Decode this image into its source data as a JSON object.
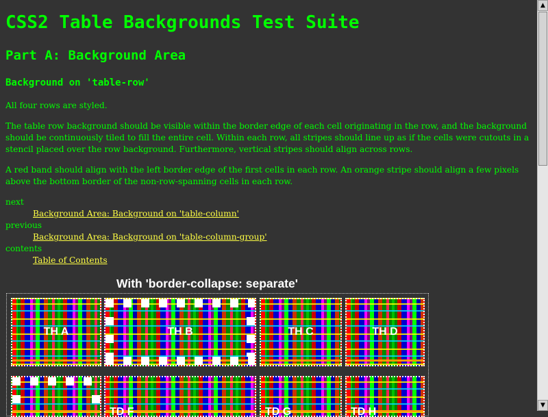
{
  "page": {
    "title": "CSS2 Table Backgrounds Test Suite",
    "part": "Part A: Background Area",
    "section": "Background on 'table-row'",
    "paragraphs": [
      "All four rows are styled.",
      "The table row background should be visible within the border edge of each cell originating in the row, and the background should be continuously tiled to fill the entire cell. Within each row, all stripes should line up as if the cells were cutouts in a stencil placed over the row background. Furthermore, vertical stripes should align across rows.",
      "A red band should align with the left border edge of the first cells in each row. An orange stripe should align a few pixels above the bottom border of the non-row-spanning cells in each row."
    ]
  },
  "nav": {
    "next_label": "next",
    "next_link": "Background Area: Background on 'table-column'",
    "previous_label": "previous",
    "previous_link": "Background Area: Background on 'table-column-group'",
    "contents_label": "contents",
    "contents_link": "Table of Contents"
  },
  "demo": {
    "caption": "With 'border-collapse: separate'",
    "cells": {
      "a": "TH A",
      "b": "TH B",
      "c": "TH C",
      "d": "TH D",
      "f": "TD F",
      "g": "TD G",
      "h": "TD H"
    }
  },
  "colors": {
    "background": "#333333",
    "text": "#00ff00",
    "link": "#ffff44",
    "caption": "#ffffff"
  },
  "scrollbar": {
    "up_icon": "arrow-up-icon",
    "down_icon": "arrow-down-icon"
  }
}
